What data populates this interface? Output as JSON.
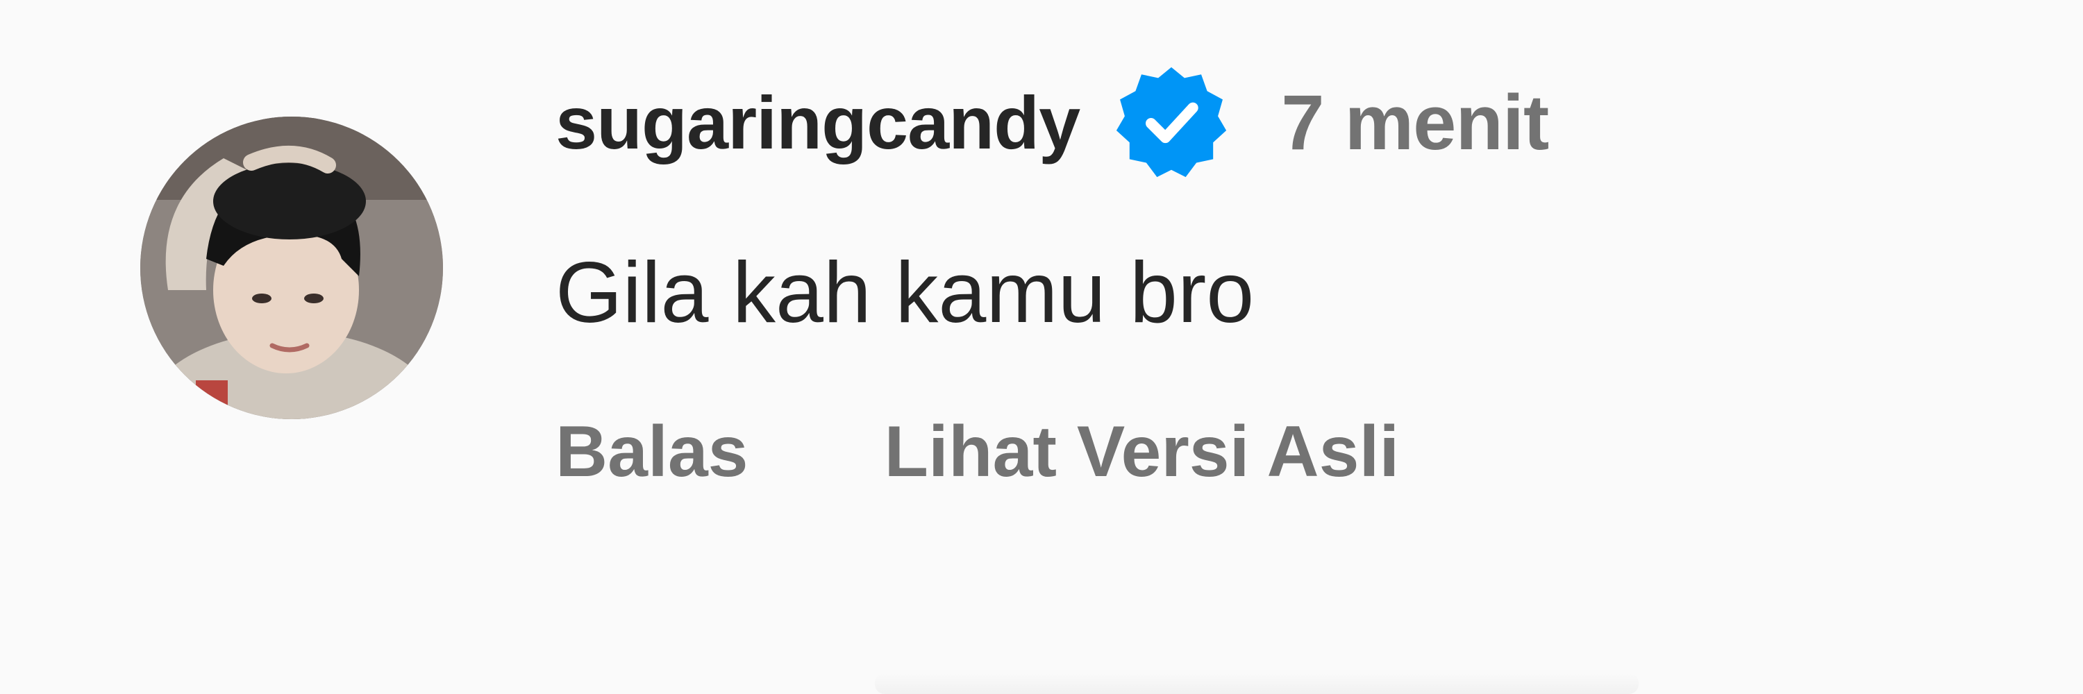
{
  "comment": {
    "avatar_icon": "user-avatar-photo",
    "username": "sugaringcandy",
    "verified_icon": "verified-badge-icon",
    "time": "7 menit",
    "text": "Gila kah kamu bro",
    "actions": {
      "reply": "Balas",
      "see_original": "Lihat Versi Asli"
    }
  },
  "colors": {
    "background": "#fafafa",
    "primary_text": "#262626",
    "secondary_text": "#737373",
    "verified_blue": "#0095f6"
  }
}
